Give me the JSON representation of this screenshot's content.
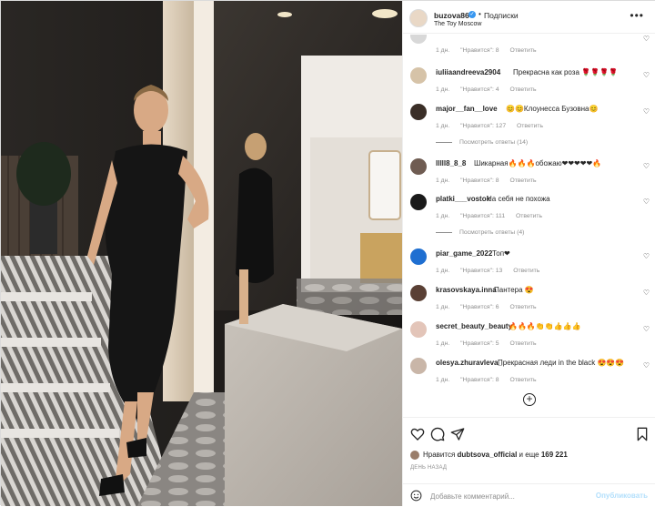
{
  "header": {
    "username": "buzova86",
    "follow_dot": "•",
    "follow_label": "Подписки",
    "location": "The Toy Moscow",
    "more_icon": "more-horizontal-icon"
  },
  "comments": [
    {
      "username": "",
      "text": "",
      "time": "1 дн.",
      "likes": "\"Нравится\": 8",
      "reply": "Ответить",
      "avatar_color": "#d8d8d8",
      "partial": true
    },
    {
      "username": "iuliiaandreeva2904",
      "text": "Прекрасна как роза 🌹🌹🌹🌹",
      "time": "1 дн.",
      "likes": "\"Нравится\": 4",
      "reply": "Ответить",
      "avatar_color": "#d6c3a8"
    },
    {
      "username": "major__fan__love",
      "text": "😊😊Клоунесса Бузовна😊",
      "time": "1 дн.",
      "likes": "\"Нравится\": 127",
      "reply": "Ответить",
      "avatar_color": "#3a2e27",
      "replies": "Посмотреть ответы (14)"
    },
    {
      "username": "lllll8_8_8",
      "text": "Шикарная🔥🔥🔥обожаю❤❤❤❤❤🔥",
      "time": "1 дн.",
      "likes": "\"Нравится\": 8",
      "reply": "Ответить",
      "avatar_color": "#6f5c52"
    },
    {
      "username": "platki___vostok",
      "text": "На себя не похожа",
      "time": "1 дн.",
      "likes": "\"Нравится\": 111",
      "reply": "Ответить",
      "avatar_color": "#1a1a1a",
      "replies": "Посмотреть ответы (4)"
    },
    {
      "username": "piar_game_2022",
      "text": "Топ❤",
      "time": "1 дн.",
      "likes": "\"Нравится\": 13",
      "reply": "Ответить",
      "avatar_color": "#1f6fd1"
    },
    {
      "username": "krasovskaya.inna",
      "text": "Пантера 😍",
      "time": "1 дн.",
      "likes": "\"Нравится\": 6",
      "reply": "Ответить",
      "avatar_color": "#5a4035"
    },
    {
      "username": "secret_beauty_beauty",
      "text": "🔥🔥🔥👏👏👍👍👍",
      "time": "1 дн.",
      "likes": "\"Нравится\": 5",
      "reply": "Ответить",
      "avatar_color": "#e3c5b9"
    },
    {
      "username": "olesya.zhuravleva_",
      "text": "Прекрасная леди in the black 😍😍😍",
      "time": "1 дн.",
      "likes": "\"Нравится\": 8",
      "reply": "Ответить",
      "avatar_color": "#c9b6a8"
    }
  ],
  "actions": {
    "like_icon": "heart-icon",
    "comment_icon": "comment-icon",
    "share_icon": "share-icon",
    "save_icon": "bookmark-icon",
    "liked_by_prefix": "Нравится ",
    "liked_by_user": "dubtsova_official",
    "liked_by_mid": " и еще ",
    "liked_by_count": "169 221",
    "timestamp": "ДЕНЬ НАЗАД"
  },
  "add_comment": {
    "placeholder": "Добавьте комментарий...",
    "post_label": "Опубликовать"
  },
  "load_more_icon": "plus-circle-icon"
}
